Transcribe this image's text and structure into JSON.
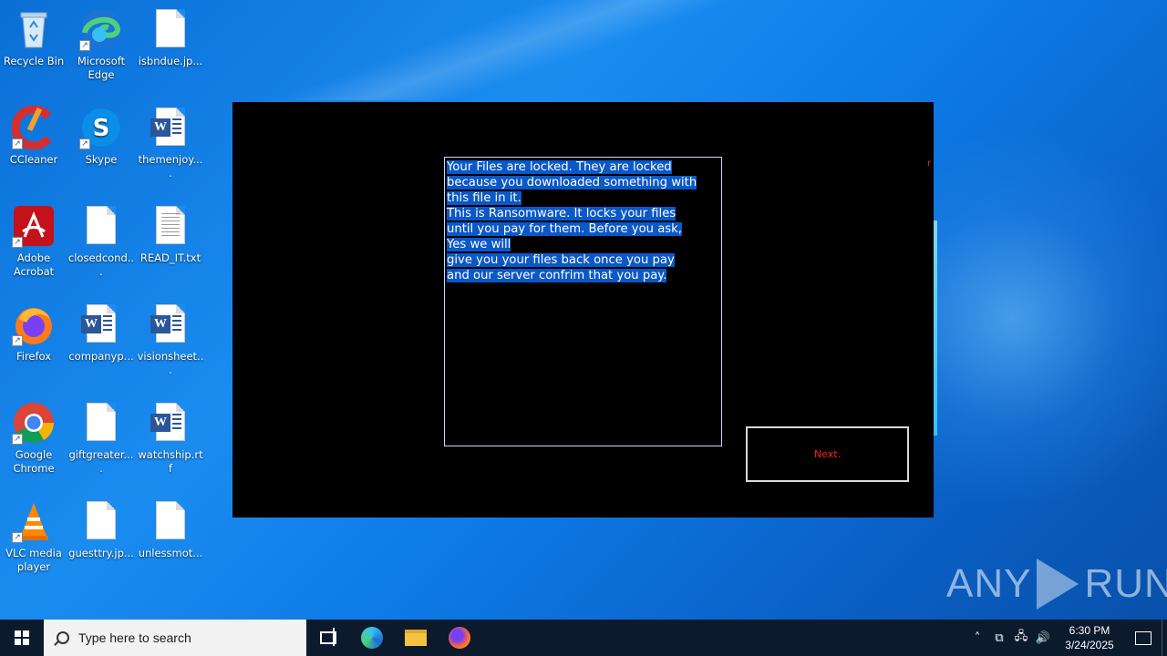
{
  "desktop": {
    "icons": [
      {
        "label": "Recycle Bin",
        "icon": "recycle-bin-icon"
      },
      {
        "label": "Microsoft Edge",
        "icon": "edge-icon"
      },
      {
        "label": "isbndue.jp...",
        "icon": "blank-file-icon"
      },
      {
        "label": "CCleaner",
        "icon": "ccleaner-icon"
      },
      {
        "label": "Skype",
        "icon": "skype-icon"
      },
      {
        "label": "themenjoy....",
        "icon": "word-doc-icon"
      },
      {
        "label": "Adobe Acrobat",
        "icon": "acrobat-icon"
      },
      {
        "label": "closedcond...",
        "icon": "blank-file-icon"
      },
      {
        "label": "READ_IT.txt",
        "icon": "text-file-icon"
      },
      {
        "label": "Firefox",
        "icon": "firefox-icon"
      },
      {
        "label": "companyp...",
        "icon": "word-doc-icon"
      },
      {
        "label": "visionsheet...",
        "icon": "word-doc-icon"
      },
      {
        "label": "Google Chrome",
        "icon": "chrome-icon"
      },
      {
        "label": "giftgreater....",
        "icon": "blank-file-icon"
      },
      {
        "label": "watchship.rtf",
        "icon": "word-doc-icon"
      },
      {
        "label": "VLC media player",
        "icon": "vlc-icon"
      },
      {
        "label": "guesttry.jp...",
        "icon": "blank-file-icon"
      },
      {
        "label": "unlessmot...",
        "icon": "blank-file-icon"
      }
    ]
  },
  "ransom": {
    "lines": [
      "Your Files are locked. They are locked",
      "because you downloaded something with",
      "this file in it.",
      "This is Ransomware. It locks your files",
      "until you pay for them. Before you ask,",
      "Yes we will",
      "give you your files back once you pay",
      "and our server confrim that you pay."
    ],
    "mark": "r",
    "next_label": "Next.",
    "text_color": "#ffffff",
    "selection_color": "#0b58c8",
    "button_text_color": "#ff2020"
  },
  "watermark": {
    "left": "ANY",
    "right": "RUN"
  },
  "taskbar": {
    "search_placeholder": "Type here to search",
    "clock_time": "6:30 PM",
    "clock_date": "3/24/2025"
  }
}
